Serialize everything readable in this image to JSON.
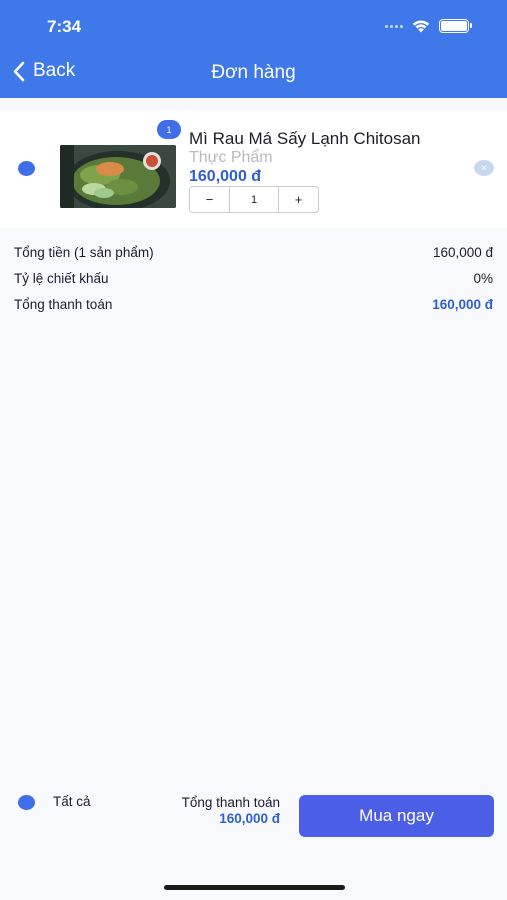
{
  "status_bar": {
    "time": "7:34"
  },
  "header": {
    "back_label": "Back",
    "title": "Đơn hàng"
  },
  "cart": {
    "items": [
      {
        "badge": "1",
        "name": "Mì Rau Má Sấy Lạnh Chitosan",
        "category": "Thực Phẩm",
        "price": "160,000 đ",
        "quantity": "1",
        "decrement": "−",
        "increment": "+",
        "remove": "×"
      }
    ]
  },
  "summary": {
    "subtotal_label": "Tổng tiền (1 sản phẩm)",
    "subtotal_value": "160,000 đ",
    "discount_label": "Tỷ lệ chiết khấu",
    "discount_value": "0%",
    "total_label": "Tổng thanh toán",
    "total_value": "160,000 đ"
  },
  "footer": {
    "select_all_label": "Tất cả",
    "total_label": "Tổng thanh toán",
    "total_value": "160,000 đ",
    "buy_label": "Mua ngay"
  },
  "colors": {
    "header": "#3f78e8",
    "accent": "#2f5fd0",
    "radio": "#3f6ee8",
    "buy_button": "#4a5fe6"
  }
}
